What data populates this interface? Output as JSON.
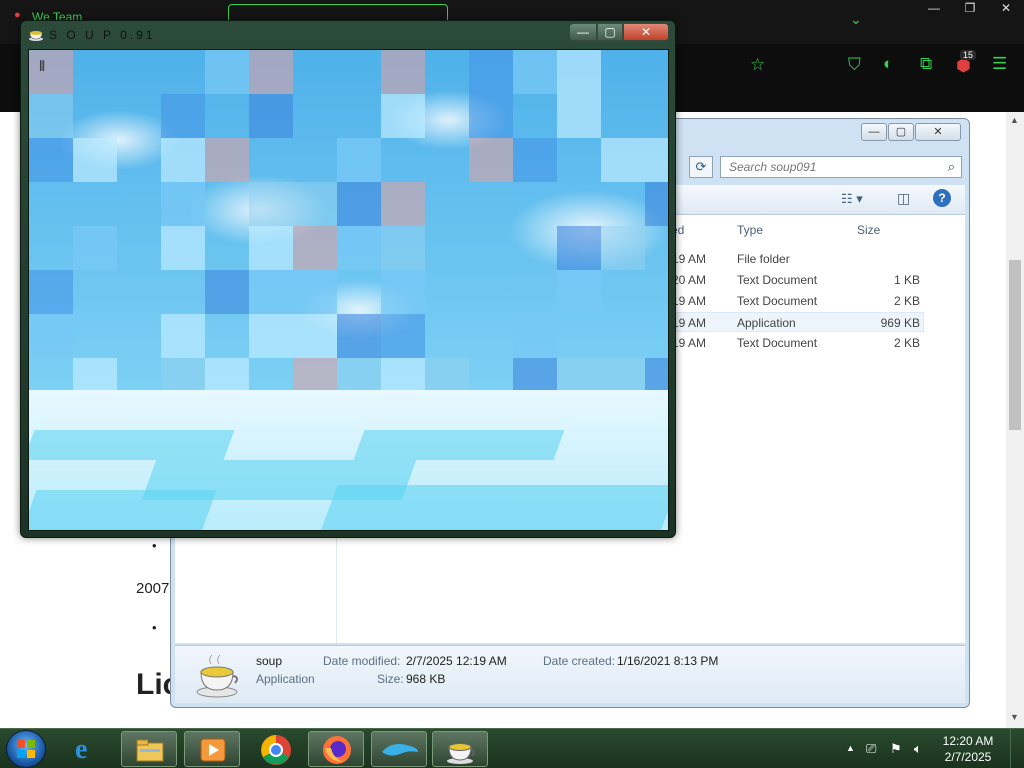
{
  "browser": {
    "tab_title": "We Team",
    "badge_count": "15",
    "page_text": {
      "year": "2007",
      "heading": "Lic"
    }
  },
  "explorer": {
    "search_placeholder": "Search soup091",
    "columns": {
      "date": "ed",
      "type": "Type",
      "size": "Size"
    },
    "rows": [
      {
        "date": "19 AM",
        "type": "File folder",
        "size": ""
      },
      {
        "date": "20 AM",
        "type": "Text Document",
        "size": "1 KB"
      },
      {
        "date": "19 AM",
        "type": "Text Document",
        "size": "2 KB"
      },
      {
        "date": "19 AM",
        "type": "Application",
        "size": "969 KB"
      },
      {
        "date": "19 AM",
        "type": "Text Document",
        "size": "2 KB"
      }
    ],
    "details": {
      "name": "soup",
      "kind": "Application",
      "date_modified_label": "Date modified:",
      "date_modified": "2/7/2025 12:19 AM",
      "date_created_label": "Date created:",
      "date_created": "1/16/2021 8:13 PM",
      "size_label": "Size:",
      "size": "968 KB"
    }
  },
  "soup": {
    "title": "S O U P 0.91"
  },
  "taskbar": {
    "time": "12:20 AM",
    "date": "2/7/2025"
  },
  "icons": [
    "windows-start-icon",
    "ie-icon",
    "explorer-icon",
    "media-player-icon",
    "chrome-icon",
    "firefox-icon",
    "dolphin-icon",
    "soup-icon",
    "search-icon",
    "refresh-icon",
    "help-icon",
    "paperclip-icon",
    "flag-icon",
    "volume-icon",
    "network-icon",
    "star-icon",
    "shield-icon",
    "puzzle-icon",
    "menu-icon"
  ],
  "colors": {
    "accent_green": "#39d353",
    "taskbar": "#1a331e",
    "sky_blue": "#4fb1ea"
  }
}
